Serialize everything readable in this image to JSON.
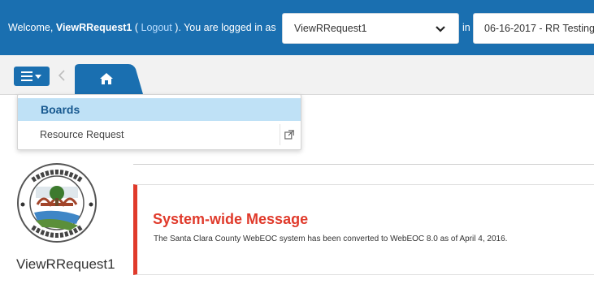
{
  "header": {
    "welcome_prefix": "Welcome, ",
    "username": "ViewRRequest1",
    "logout_open": " ( ",
    "logout_label": "Logout",
    "logout_close": " ). You are logged in as",
    "position_value": "ViewRRequest1",
    "in_label": "in",
    "incident_value": "06-16-2017 - RR Testing"
  },
  "toolbar": {
    "menu_icon": "hamburger-caret-icon",
    "back_icon": "chevron-left-icon",
    "home_icon": "home-icon"
  },
  "dropdown": {
    "header": "Boards",
    "items": [
      {
        "label": "Resource Request",
        "icon": "external-link-icon"
      }
    ]
  },
  "main": {
    "user_label": "ViewRRequest1",
    "message_title": "System-wide Message",
    "message_body": "The Santa Clara County WebEOC system has been converted to WebEOC 8.0 as of April 4, 2016."
  },
  "colors": {
    "brand_blue": "#1a6fb0",
    "alert_red": "#e03a2b",
    "menu_highlight": "#bfe1f6"
  }
}
